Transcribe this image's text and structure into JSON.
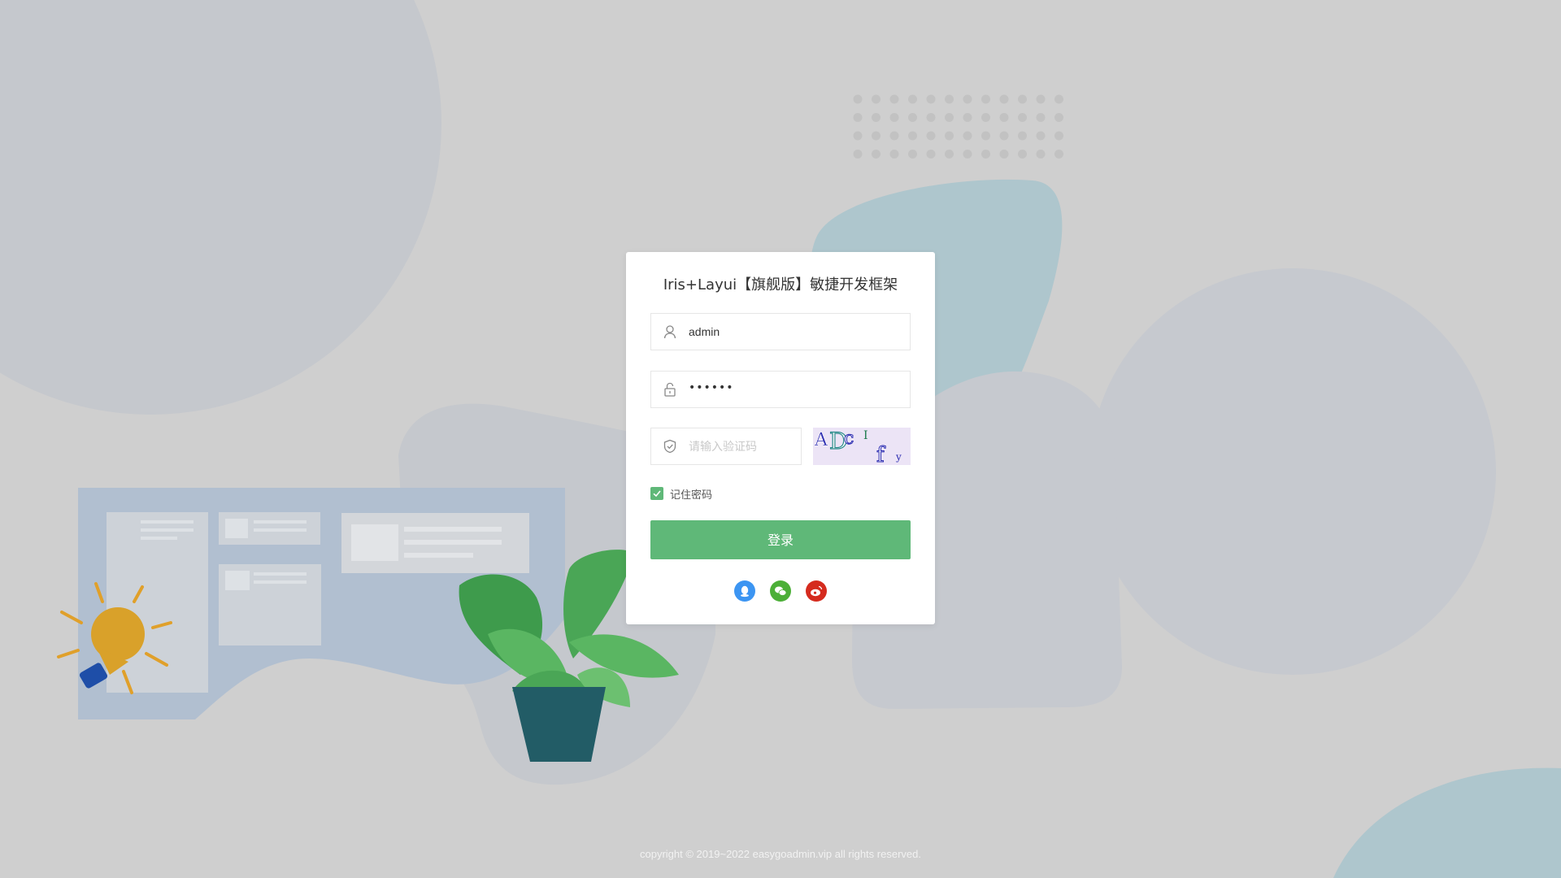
{
  "login": {
    "title": "Iris+Layui【旗舰版】敏捷开发框架",
    "username": {
      "value": "admin",
      "icon": "user-icon"
    },
    "password": {
      "masked_value": "••••••",
      "icon": "lock-icon"
    },
    "captcha": {
      "placeholder": "请输入验证码",
      "icon": "shield-check-icon",
      "image_text": "ADc I f y"
    },
    "remember": {
      "label": "记住密码",
      "checked": true
    },
    "submit_label": "登录",
    "social": [
      {
        "name": "qq",
        "icon": "qq-icon",
        "color": "#3c95f2"
      },
      {
        "name": "wechat",
        "icon": "wechat-icon",
        "color": "#4caf38"
      },
      {
        "name": "weibo",
        "icon": "weibo-icon",
        "color": "#d52b1e"
      }
    ]
  },
  "footer": {
    "copyright": "copyright © 2019~2022 easygoadmin.vip all rights reserved."
  },
  "colors": {
    "accent": "#5fb878",
    "background": "#cfcfcf"
  }
}
